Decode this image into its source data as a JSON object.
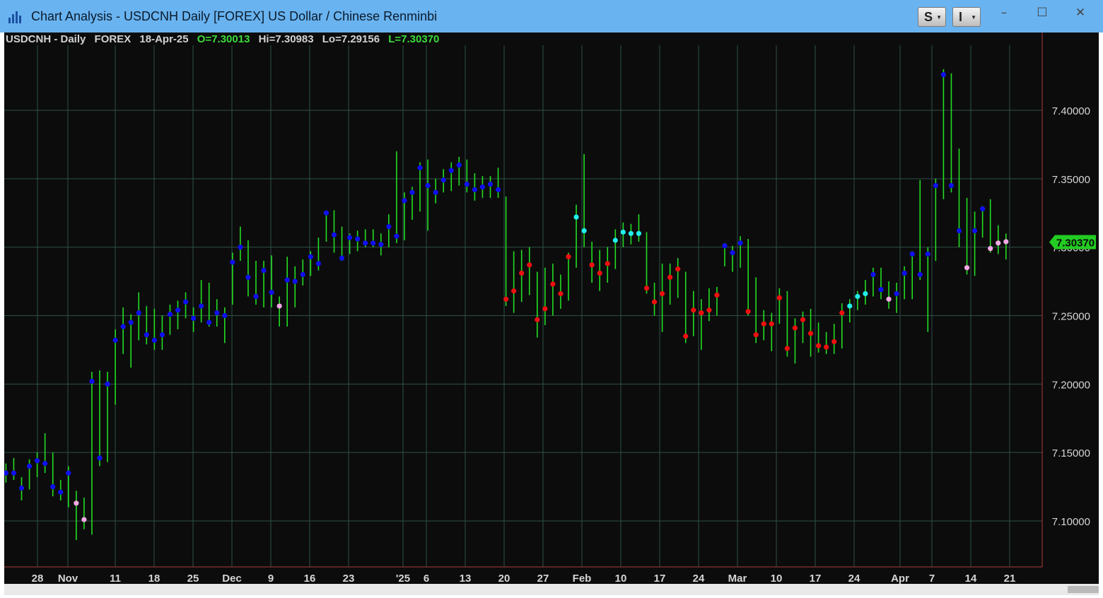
{
  "window": {
    "title": "Chart Analysis - USDCNH Daily [FOREX] US Dollar / Chinese Renminbi",
    "buttons": [
      {
        "name": "s-button",
        "label": "S"
      },
      {
        "name": "i-button",
        "label": "I"
      }
    ],
    "controls": {
      "minimize": "–",
      "maximize": "☐",
      "close": "✕"
    }
  },
  "header": {
    "symbol": "USDCNH - Daily",
    "exchange": "FOREX",
    "date": "18-Apr-25",
    "open": "O=7.30013",
    "high": "Hi=7.30983",
    "low": "Lo=7.29156",
    "last": "L=7.30370"
  },
  "colors": {
    "background": "#0c0c0c",
    "grid": "#2e5047",
    "bar": "#22dd22",
    "dot_blue": "#1010f0",
    "dot_red": "#ee1010",
    "dot_cyan": "#22eeee",
    "dot_pink": "#f4a8e6",
    "axis_text": "#d6d6d6",
    "last_price_badge": "#22cc22"
  },
  "chart_data": {
    "type": "ohlc-bar",
    "symbol": "USDCNH",
    "interval": "Daily",
    "y_range": [
      7.05,
      7.47
    ],
    "y_ticks": [
      "7.10000",
      "7.15000",
      "7.20000",
      "7.25000",
      "7.30000",
      "7.35000",
      "7.40000"
    ],
    "x_ticks": [
      "28",
      "Nov",
      "11",
      "18",
      "25",
      "Dec",
      "9",
      "16",
      "23",
      "'25",
      "6",
      "13",
      "20",
      "27",
      "Feb",
      "10",
      "17",
      "24",
      "Mar",
      "10",
      "17",
      "24",
      "Apr",
      "7",
      "14",
      "21"
    ],
    "last_price_label": "7.30370",
    "last_price": 7.3037,
    "bars": [
      {
        "h": 7.142,
        "l": 7.128,
        "c": 7.135,
        "dot": "blue"
      },
      {
        "h": 7.146,
        "l": 7.13,
        "c": 7.135,
        "dot": "blue"
      },
      {
        "h": 7.132,
        "l": 7.115,
        "c": 7.124,
        "dot": "blue"
      },
      {
        "h": 7.145,
        "l": 7.123,
        "c": 7.14,
        "dot": "blue"
      },
      {
        "h": 7.15,
        "l": 7.132,
        "c": 7.144,
        "dot": "blue"
      },
      {
        "h": 7.164,
        "l": 7.135,
        "c": 7.142,
        "dot": "blue"
      },
      {
        "h": 7.15,
        "l": 7.118,
        "c": 7.125,
        "dot": "blue"
      },
      {
        "h": 7.13,
        "l": 7.115,
        "c": 7.121,
        "dot": "blue"
      },
      {
        "h": 7.14,
        "l": 7.11,
        "c": 7.135,
        "dot": "blue"
      },
      {
        "h": 7.122,
        "l": 7.086,
        "c": 7.113,
        "dot": "pink"
      },
      {
        "h": 7.117,
        "l": 7.094,
        "c": 7.101,
        "dot": "pink"
      },
      {
        "h": 7.209,
        "l": 7.09,
        "c": 7.202,
        "dot": "blue"
      },
      {
        "h": 7.21,
        "l": 7.14,
        "c": 7.146,
        "dot": "blue"
      },
      {
        "h": 7.209,
        "l": 7.143,
        "c": 7.2,
        "dot": "blue"
      },
      {
        "h": 7.24,
        "l": 7.185,
        "c": 7.232,
        "dot": "blue"
      },
      {
        "h": 7.256,
        "l": 7.222,
        "c": 7.242,
        "dot": "blue"
      },
      {
        "h": 7.251,
        "l": 7.212,
        "c": 7.245,
        "dot": "blue"
      },
      {
        "h": 7.267,
        "l": 7.232,
        "c": 7.252,
        "dot": "blue"
      },
      {
        "h": 7.257,
        "l": 7.229,
        "c": 7.236,
        "dot": "blue"
      },
      {
        "h": 7.255,
        "l": 7.225,
        "c": 7.232,
        "dot": "blue"
      },
      {
        "h": 7.25,
        "l": 7.225,
        "c": 7.236,
        "dot": "blue"
      },
      {
        "h": 7.258,
        "l": 7.236,
        "c": 7.251,
        "dot": "blue"
      },
      {
        "h": 7.261,
        "l": 7.24,
        "c": 7.254,
        "dot": "blue"
      },
      {
        "h": 7.267,
        "l": 7.248,
        "c": 7.26,
        "dot": "blue"
      },
      {
        "h": 7.256,
        "l": 7.238,
        "c": 7.248,
        "dot": "blue"
      },
      {
        "h": 7.276,
        "l": 7.245,
        "c": 7.257,
        "dot": "blue"
      },
      {
        "h": 7.274,
        "l": 7.242,
        "c": 7.245,
        "dot": "blue"
      },
      {
        "h": 7.262,
        "l": 7.242,
        "c": 7.252,
        "dot": "blue"
      },
      {
        "h": 7.256,
        "l": 7.23,
        "c": 7.25,
        "dot": "blue"
      },
      {
        "h": 7.296,
        "l": 7.258,
        "c": 7.289,
        "dot": "blue"
      },
      {
        "h": 7.315,
        "l": 7.29,
        "c": 7.3,
        "dot": "blue"
      },
      {
        "h": 7.305,
        "l": 7.264,
        "c": 7.278,
        "dot": "blue"
      },
      {
        "h": 7.29,
        "l": 7.258,
        "c": 7.264,
        "dot": "blue"
      },
      {
        "h": 7.29,
        "l": 7.256,
        "c": 7.283,
        "dot": "blue"
      },
      {
        "h": 7.294,
        "l": 7.256,
        "c": 7.267,
        "dot": "blue"
      },
      {
        "h": 7.264,
        "l": 7.242,
        "c": 7.257,
        "dot": "pink"
      },
      {
        "h": 7.293,
        "l": 7.242,
        "c": 7.276,
        "dot": "blue"
      },
      {
        "h": 7.286,
        "l": 7.256,
        "c": 7.275,
        "dot": "blue"
      },
      {
        "h": 7.291,
        "l": 7.272,
        "c": 7.28,
        "dot": "blue"
      },
      {
        "h": 7.297,
        "l": 7.279,
        "c": 7.293,
        "dot": "blue"
      },
      {
        "h": 7.307,
        "l": 7.283,
        "c": 7.288,
        "dot": "blue"
      },
      {
        "h": 7.326,
        "l": 7.304,
        "c": 7.325,
        "dot": "blue"
      },
      {
        "h": 7.327,
        "l": 7.296,
        "c": 7.309,
        "dot": "blue"
      },
      {
        "h": 7.315,
        "l": 7.29,
        "c": 7.292,
        "dot": "blue"
      },
      {
        "h": 7.31,
        "l": 7.295,
        "c": 7.307,
        "dot": "blue"
      },
      {
        "h": 7.312,
        "l": 7.297,
        "c": 7.306,
        "dot": "blue"
      },
      {
        "h": 7.313,
        "l": 7.3,
        "c": 7.303,
        "dot": "blue"
      },
      {
        "h": 7.313,
        "l": 7.3,
        "c": 7.303,
        "dot": "blue"
      },
      {
        "h": 7.31,
        "l": 7.294,
        "c": 7.302,
        "dot": "blue"
      },
      {
        "h": 7.324,
        "l": 7.3,
        "c": 7.315,
        "dot": "blue"
      },
      {
        "h": 7.37,
        "l": 7.303,
        "c": 7.308,
        "dot": "blue"
      },
      {
        "h": 7.34,
        "l": 7.305,
        "c": 7.334,
        "dot": "blue"
      },
      {
        "h": 7.344,
        "l": 7.32,
        "c": 7.34,
        "dot": "blue"
      },
      {
        "h": 7.362,
        "l": 7.326,
        "c": 7.358,
        "dot": "blue"
      },
      {
        "h": 7.364,
        "l": 7.312,
        "c": 7.345,
        "dot": "blue"
      },
      {
        "h": 7.35,
        "l": 7.332,
        "c": 7.34,
        "dot": "blue"
      },
      {
        "h": 7.357,
        "l": 7.34,
        "c": 7.349,
        "dot": "blue"
      },
      {
        "h": 7.362,
        "l": 7.341,
        "c": 7.356,
        "dot": "blue"
      },
      {
        "h": 7.366,
        "l": 7.345,
        "c": 7.36,
        "dot": "blue"
      },
      {
        "h": 7.364,
        "l": 7.34,
        "c": 7.346,
        "dot": "blue"
      },
      {
        "h": 7.354,
        "l": 7.334,
        "c": 7.342,
        "dot": "blue"
      },
      {
        "h": 7.352,
        "l": 7.336,
        "c": 7.344,
        "dot": "blue"
      },
      {
        "h": 7.352,
        "l": 7.336,
        "c": 7.346,
        "dot": "blue"
      },
      {
        "h": 7.358,
        "l": 7.336,
        "c": 7.342,
        "dot": "blue"
      },
      {
        "h": 7.337,
        "l": 7.257,
        "c": 7.262,
        "dot": "red"
      },
      {
        "h": 7.297,
        "l": 7.252,
        "c": 7.268,
        "dot": "red"
      },
      {
        "h": 7.298,
        "l": 7.26,
        "c": 7.281,
        "dot": "red"
      },
      {
        "h": 7.3,
        "l": 7.265,
        "c": 7.287,
        "dot": "red"
      },
      {
        "h": 7.282,
        "l": 7.234,
        "c": 7.247,
        "dot": "red"
      },
      {
        "h": 7.285,
        "l": 7.243,
        "c": 7.255,
        "dot": "red"
      },
      {
        "h": 7.288,
        "l": 7.25,
        "c": 7.273,
        "dot": "red"
      },
      {
        "h": 7.28,
        "l": 7.255,
        "c": 7.266,
        "dot": "red"
      },
      {
        "h": 7.296,
        "l": 7.261,
        "c": 7.293,
        "dot": "red"
      },
      {
        "h": 7.331,
        "l": 7.285,
        "c": 7.322,
        "dot": "cyan"
      },
      {
        "h": 7.368,
        "l": 7.3,
        "c": 7.312,
        "dot": "cyan"
      },
      {
        "h": 7.304,
        "l": 7.274,
        "c": 7.287,
        "dot": "red"
      },
      {
        "h": 7.298,
        "l": 7.268,
        "c": 7.281,
        "dot": "red"
      },
      {
        "h": 7.3,
        "l": 7.274,
        "c": 7.288,
        "dot": "red"
      },
      {
        "h": 7.313,
        "l": 7.284,
        "c": 7.305,
        "dot": "cyan"
      },
      {
        "h": 7.318,
        "l": 7.3,
        "c": 7.311,
        "dot": "cyan"
      },
      {
        "h": 7.317,
        "l": 7.302,
        "c": 7.31,
        "dot": "cyan"
      },
      {
        "h": 7.324,
        "l": 7.304,
        "c": 7.31,
        "dot": "cyan"
      },
      {
        "h": 7.311,
        "l": 7.266,
        "c": 7.27,
        "dot": "red"
      },
      {
        "h": 7.274,
        "l": 7.25,
        "c": 7.26,
        "dot": "red"
      },
      {
        "h": 7.288,
        "l": 7.238,
        "c": 7.266,
        "dot": "red"
      },
      {
        "h": 7.288,
        "l": 7.258,
        "c": 7.278,
        "dot": "red"
      },
      {
        "h": 7.292,
        "l": 7.263,
        "c": 7.284,
        "dot": "red"
      },
      {
        "h": 7.282,
        "l": 7.23,
        "c": 7.235,
        "dot": "red"
      },
      {
        "h": 7.268,
        "l": 7.235,
        "c": 7.254,
        "dot": "red"
      },
      {
        "h": 7.262,
        "l": 7.225,
        "c": 7.252,
        "dot": "red"
      },
      {
        "h": 7.27,
        "l": 7.246,
        "c": 7.254,
        "dot": "red"
      },
      {
        "h": 7.271,
        "l": 7.25,
        "c": 7.265,
        "dot": "red"
      },
      {
        "h": 7.303,
        "l": 7.286,
        "c": 7.301,
        "dot": "blue"
      },
      {
        "h": 7.301,
        "l": 7.282,
        "c": 7.296,
        "dot": "blue"
      },
      {
        "h": 7.308,
        "l": 7.285,
        "c": 7.303,
        "dot": "blue"
      },
      {
        "h": 7.306,
        "l": 7.25,
        "c": 7.253,
        "dot": "red"
      },
      {
        "h": 7.278,
        "l": 7.23,
        "c": 7.236,
        "dot": "red"
      },
      {
        "h": 7.254,
        "l": 7.232,
        "c": 7.244,
        "dot": "red"
      },
      {
        "h": 7.252,
        "l": 7.224,
        "c": 7.244,
        "dot": "red"
      },
      {
        "h": 7.27,
        "l": 7.244,
        "c": 7.263,
        "dot": "red"
      },
      {
        "h": 7.268,
        "l": 7.22,
        "c": 7.226,
        "dot": "red"
      },
      {
        "h": 7.248,
        "l": 7.215,
        "c": 7.241,
        "dot": "red"
      },
      {
        "h": 7.253,
        "l": 7.23,
        "c": 7.247,
        "dot": "red"
      },
      {
        "h": 7.255,
        "l": 7.22,
        "c": 7.237,
        "dot": "red"
      },
      {
        "h": 7.245,
        "l": 7.223,
        "c": 7.228,
        "dot": "red"
      },
      {
        "h": 7.238,
        "l": 7.222,
        "c": 7.227,
        "dot": "red"
      },
      {
        "h": 7.244,
        "l": 7.222,
        "c": 7.231,
        "dot": "red"
      },
      {
        "h": 7.259,
        "l": 7.226,
        "c": 7.252,
        "dot": "red"
      },
      {
        "h": 7.262,
        "l": 7.245,
        "c": 7.257,
        "dot": "cyan"
      },
      {
        "h": 7.268,
        "l": 7.254,
        "c": 7.264,
        "dot": "cyan"
      },
      {
        "h": 7.276,
        "l": 7.258,
        "c": 7.266,
        "dot": "cyan"
      },
      {
        "h": 7.285,
        "l": 7.264,
        "c": 7.28,
        "dot": "blue"
      },
      {
        "h": 7.285,
        "l": 7.262,
        "c": 7.269,
        "dot": "blue"
      },
      {
        "h": 7.275,
        "l": 7.255,
        "c": 7.262,
        "dot": "pink"
      },
      {
        "h": 7.274,
        "l": 7.252,
        "c": 7.266,
        "dot": "blue"
      },
      {
        "h": 7.286,
        "l": 7.262,
        "c": 7.281,
        "dot": "blue"
      },
      {
        "h": 7.297,
        "l": 7.262,
        "c": 7.295,
        "dot": "blue"
      },
      {
        "h": 7.349,
        "l": 7.276,
        "c": 7.28,
        "dot": "blue"
      },
      {
        "h": 7.3,
        "l": 7.238,
        "c": 7.295,
        "dot": "blue"
      },
      {
        "h": 7.35,
        "l": 7.29,
        "c": 7.345,
        "dot": "blue"
      },
      {
        "h": 7.43,
        "l": 7.335,
        "c": 7.426,
        "dot": "blue"
      },
      {
        "h": 7.427,
        "l": 7.34,
        "c": 7.345,
        "dot": "blue"
      },
      {
        "h": 7.372,
        "l": 7.3,
        "c": 7.312,
        "dot": "blue"
      },
      {
        "h": 7.336,
        "l": 7.28,
        "c": 7.285,
        "dot": "pink"
      },
      {
        "h": 7.326,
        "l": 7.279,
        "c": 7.312,
        "dot": "blue"
      },
      {
        "h": 7.33,
        "l": 7.307,
        "c": 7.328,
        "dot": "blue"
      },
      {
        "h": 7.335,
        "l": 7.296,
        "c": 7.299,
        "dot": "pink"
      },
      {
        "h": 7.316,
        "l": 7.295,
        "c": 7.303,
        "dot": "pink"
      },
      {
        "h": 7.31,
        "l": 7.291,
        "c": 7.304,
        "dot": "pink"
      }
    ]
  }
}
